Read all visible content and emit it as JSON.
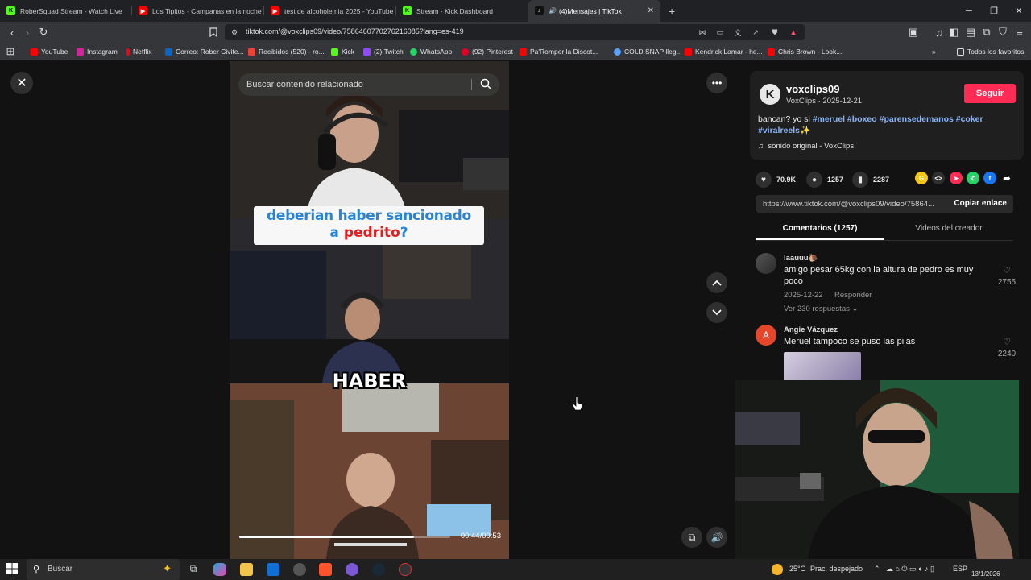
{
  "browser": {
    "tabs": [
      {
        "title": "RoberSquad Stream - Watch Live",
        "icon_color": "#53fc18",
        "icon": "kick-icon"
      },
      {
        "title": "Los Tipitos - Campanas en la noche (",
        "icon_color": "#ff0000",
        "icon": "youtube-icon"
      },
      {
        "title": "test de alcoholemia 2025 - YouTube",
        "icon_color": "#ff0000",
        "icon": "youtube-icon"
      },
      {
        "title": "Stream - Kick Dashboard",
        "icon_color": "#53fc18",
        "icon": "kick-icon"
      },
      {
        "title": "(4)Mensajes | TikTok",
        "icon_color": "#111111",
        "icon": "tiktok-icon",
        "active": true
      }
    ],
    "new_tab": "+",
    "url": "tiktok.com/@voxclips09/video/7586460770276216085?lang=es-419",
    "bookmarks": [
      {
        "label": "YouTube",
        "color": "#ff0000"
      },
      {
        "label": "Instagram",
        "color": "#d6249f"
      },
      {
        "label": "Netflix",
        "color": "#e50914"
      },
      {
        "label": "Correo: Rober Civite...",
        "color": "#0a66c2"
      },
      {
        "label": "Recibidos (520) - ro...",
        "color": "#ea4335"
      },
      {
        "label": "Kick",
        "color": "#53fc18"
      },
      {
        "label": "(2) Twitch",
        "color": "#9146ff"
      },
      {
        "label": "WhatsApp",
        "color": "#25d366"
      },
      {
        "label": "(92) Pinterest",
        "color": "#e60023"
      },
      {
        "label": "Pa'Romper la Discot...",
        "color": "#ff0000"
      },
      {
        "label": "COLD SNAP lleg...",
        "color": "#5aa0ff"
      },
      {
        "label": "Kendrick Lamar - he...",
        "color": "#ff0000"
      },
      {
        "label": "Chris Brown - Look...",
        "color": "#ff0000"
      }
    ],
    "all_bookmarks": "Todos los favoritos"
  },
  "video": {
    "search_placeholder": "Buscar contenido relacionado",
    "caption_line1": "deberian haber sancionado",
    "caption_line2_a": "a ",
    "caption_line2_b": "pedrito",
    "caption_line2_c": "?",
    "subtitle": "HABER",
    "time": "00:44/00:53",
    "progress": 0.83
  },
  "creator": {
    "avatar_letter": "K",
    "username": "voxclips09",
    "display_name": "VoxClips",
    "date": "2025-12-21",
    "follow": "Seguir",
    "desc_text": "bancan? yo si ",
    "tags": [
      "#meruel",
      "#boxeo",
      "#parensedemanos",
      "#coker",
      "#viralreels✨"
    ],
    "sound": "sonido original - VoxClips",
    "likes": "70.9K",
    "comments": "1257",
    "saves": "2287",
    "link": "https://www.tiktok.com/@voxclips09/video/75864...",
    "copy_link": "Copiar enlace"
  },
  "panel_tabs": {
    "comments": "Comentarios (1257)",
    "creator_videos": "Videos del creador"
  },
  "comments": [
    {
      "user": "laauuu🐌",
      "text": "amigo pesar 65kg con la altura de pedro es muy poco",
      "date": "2025-12-22",
      "reply": "Responder",
      "view_replies": "Ver 230 respuestas",
      "likes": "2755"
    },
    {
      "user": "Angie Vázquez",
      "avatar_letter": "A",
      "text": "Meruel tampoco se puso las pilas",
      "likes": "2240"
    }
  ],
  "taskbar": {
    "search": "Buscar",
    "weather": "25°C",
    "weather_desc": "Prac. despejado",
    "lang": "ESP",
    "date": "13/1/2026"
  }
}
